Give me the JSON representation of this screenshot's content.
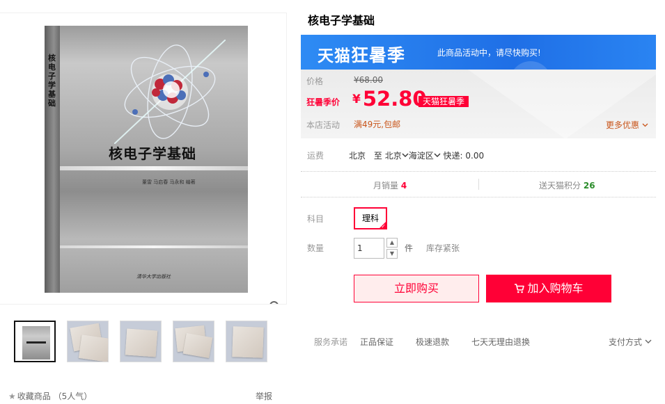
{
  "product": {
    "title": "核电子学基础",
    "collect_label": "收藏商品",
    "collect_count": "（5人气）",
    "report_label": "举报"
  },
  "book_cover": {
    "spine_text": "核电子学基础",
    "title": "核电子学基础",
    "authors": "董雷 马启春 马永和 编著",
    "publisher": "清华大学出版社"
  },
  "promo": {
    "logo_plain_1": "天猫",
    "logo_em": "狂暑季",
    "note": "此商品活动中，请尽快购买!"
  },
  "price": {
    "price_label": "价格",
    "currency": "¥",
    "original": "68.00",
    "promo_label": "狂暑季价",
    "promo_price": "52.80",
    "promo_tag": "天猫狂暑季",
    "activity_label": "本店活动",
    "activity": "满49元,包邮",
    "more_label": "更多优惠"
  },
  "shipping": {
    "label": "运费",
    "from": "北京",
    "to_word": "至",
    "to_city": "北京",
    "district": "海淀区",
    "express": "快递: 0.00"
  },
  "stats": {
    "monthly_label": "月销量",
    "monthly_value": "4",
    "points_label": "送天猫积分",
    "points_value": "26"
  },
  "subject": {
    "label": "科目",
    "selected": "理科"
  },
  "quantity": {
    "label": "数量",
    "value": "1",
    "unit": "件",
    "stock": "库存紧张"
  },
  "actions": {
    "buy_now": "立即购买",
    "add_to_cart": "加入购物车"
  },
  "services": {
    "label": "服务承诺",
    "items": [
      "正品保证",
      "极速退款",
      "七天无理由退换"
    ],
    "payment": "支付方式"
  },
  "colors": {
    "tmall_red": "#ff0036",
    "promo_blue": "#1f6fe6",
    "activity_orange": "#c9551a",
    "points_green": "#2a8c2a"
  }
}
